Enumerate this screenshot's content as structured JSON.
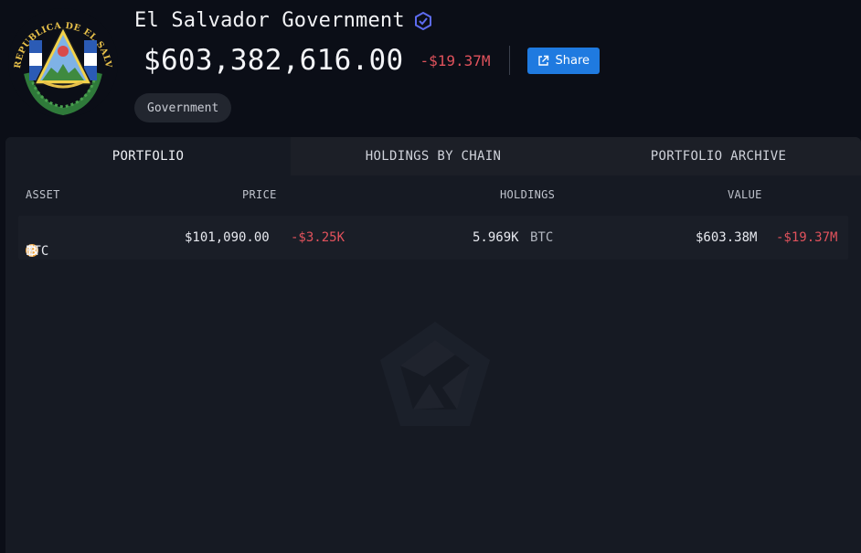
{
  "entity": {
    "name": "El Salvador Government",
    "seal_text": "REPUBLICA DE EL SALVADOR EN LA AMERICA CENTRAL",
    "balance": "$603,382,616.00",
    "balance_change": "-$19.37M",
    "share_label": "Share",
    "tag": "Government"
  },
  "tabs": [
    {
      "label": "PORTFOLIO",
      "active": true
    },
    {
      "label": "HOLDINGS BY CHAIN",
      "active": false
    },
    {
      "label": "PORTFOLIO ARCHIVE",
      "active": false
    }
  ],
  "table": {
    "headers": {
      "asset": "ASSET",
      "price": "PRICE",
      "holdings": "HOLDINGS",
      "value": "VALUE"
    },
    "rows": [
      {
        "asset": "BTC",
        "price": "$101,090.00",
        "price_change": "-$3.25K",
        "holdings": "5.969K",
        "holdings_unit": "BTC",
        "value": "$603.38M",
        "value_change": "-$19.37M"
      }
    ]
  },
  "colors": {
    "background": "#0b0e17",
    "panel": "#161a23",
    "accent": "#1f7ae0",
    "negative": "#e0525c",
    "btc": "#f2a33a"
  },
  "icons": {
    "verified": "verified-badge-icon",
    "share": "external-link-icon",
    "asset": "bitcoin-icon",
    "watermark": "arkham-logo-icon"
  }
}
